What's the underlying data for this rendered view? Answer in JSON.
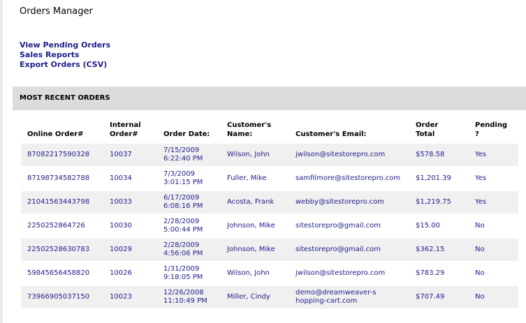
{
  "page": {
    "title": "Orders Manager",
    "links": [
      "View Pending Orders",
      "Sales Reports",
      "Export Orders (CSV)"
    ],
    "section_title": "MOST RECENT ORDERS"
  },
  "table": {
    "headers": {
      "online": "Online Order#",
      "internal": "Internal Order#",
      "date": "Order Date:",
      "name": "Customer's Name:",
      "email": "Customer's Email:",
      "total": "Order Total",
      "pending": "Pending ?"
    },
    "rows": [
      {
        "online": "87082217590328",
        "internal": "10037",
        "date": "7/15/2009 6:22:40 PM",
        "name": "Wilson, John",
        "email": "jwilson@sitestorepro.com",
        "total": "$578.58",
        "pending": "Yes"
      },
      {
        "online": "87198734582788",
        "internal": "10034",
        "date": "7/3/2009 3:01:15 PM",
        "name": "Fuller, Mike",
        "email": "samfilmore@sitestorepro.com",
        "total": "$1,201.39",
        "pending": "Yes"
      },
      {
        "online": "21041563443798",
        "internal": "10033",
        "date": "6/17/2009 6:08:16 PM",
        "name": "Acosta, Frank",
        "email": "webby@sitestorepro.com",
        "total": "$1,219.75",
        "pending": "Yes"
      },
      {
        "online": "2250252864726",
        "internal": "10030",
        "date": "2/28/2009 5:00:44 PM",
        "name": "Johnson, Mike",
        "email": "sitestorepro@gmail.com",
        "total": "$15.00",
        "pending": "No"
      },
      {
        "online": "22502528630783",
        "internal": "10029",
        "date": "2/28/2009 4:56:06 PM",
        "name": "Johnson, Mike",
        "email": "sitestorepro@gmail.com",
        "total": "$362.15",
        "pending": "No"
      },
      {
        "online": "59845656458820",
        "internal": "10026",
        "date": "1/31/2009 9:18:05 PM",
        "name": "Wilson, John",
        "email": "jwilson@sitestorepro.com",
        "total": "$783.29",
        "pending": "No"
      },
      {
        "online": "73966905037150",
        "internal": "10023",
        "date": "12/26/2008 11:10:49 PM",
        "name": "Miller, Cindy",
        "email": "demo@dreamweaver-shopping-cart.com",
        "total": "$707.49",
        "pending": "No"
      }
    ]
  },
  "colors": {
    "link": "#1e1e8c",
    "section_bar": "#dcdcdc",
    "row_shade": "#f0f0f0"
  }
}
